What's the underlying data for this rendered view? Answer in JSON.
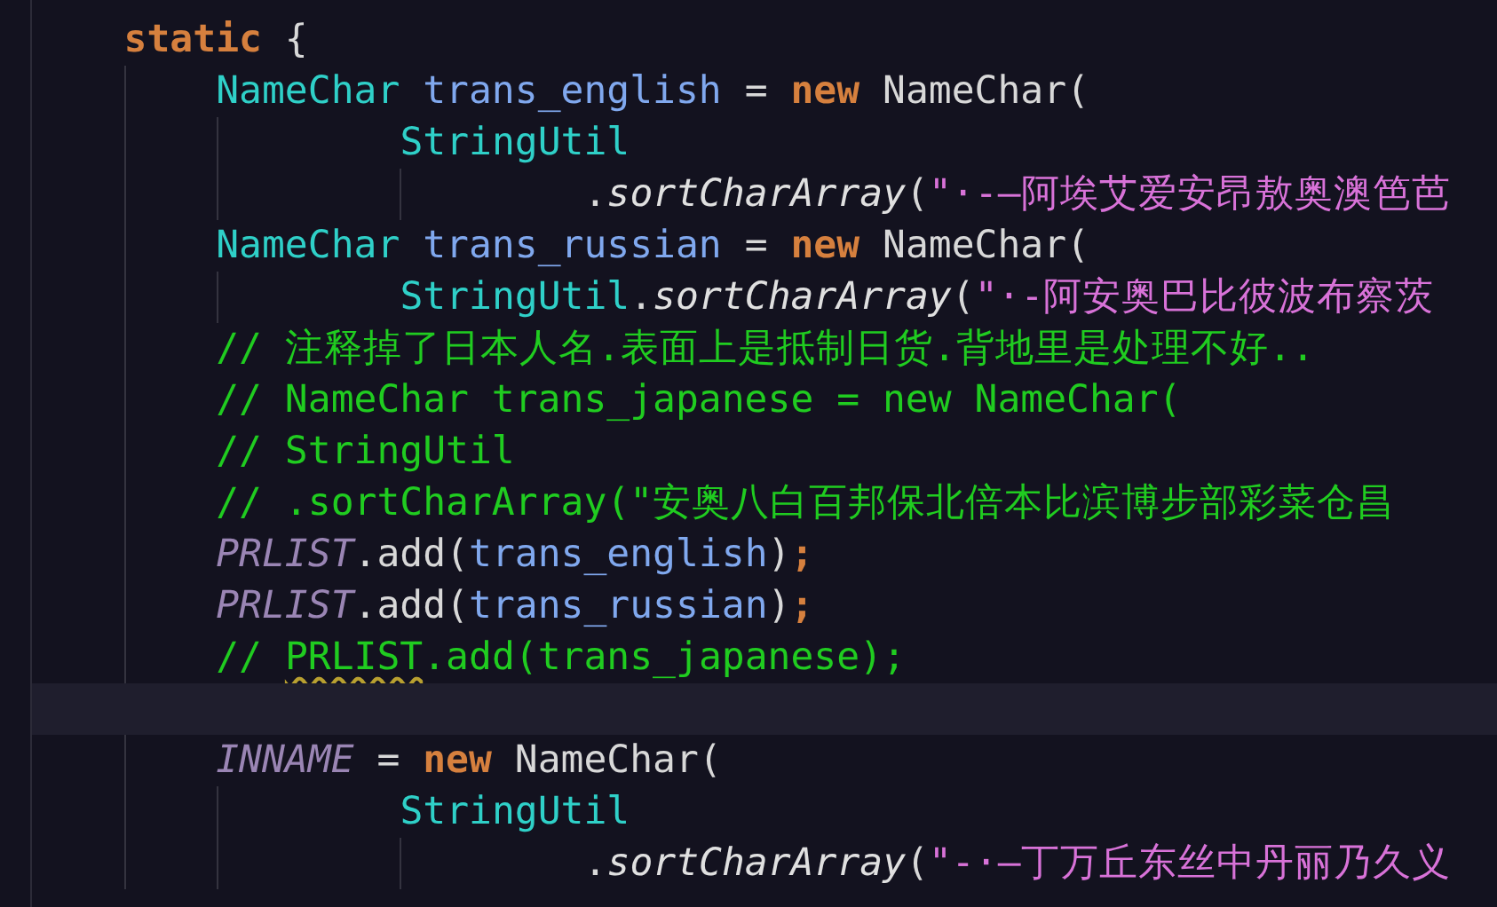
{
  "editor": {
    "lines": [
      {
        "kind": "block",
        "current": false,
        "tokens": [
          {
            "kind": "keyword",
            "text": "static"
          },
          {
            "kind": "plain",
            "text": " {"
          }
        ]
      },
      {
        "kind": "statement",
        "current": false,
        "tokens": [
          {
            "kind": "type",
            "text": "NameChar "
          },
          {
            "kind": "variable",
            "text": "trans_english"
          },
          {
            "kind": "plain",
            "text": " = "
          },
          {
            "kind": "keyword",
            "text": "new"
          },
          {
            "kind": "plain",
            "text": " NameChar("
          }
        ]
      },
      {
        "kind": "continuation",
        "current": false,
        "tokens": [
          {
            "kind": "type",
            "text": "StringUtil"
          }
        ]
      },
      {
        "kind": "argument",
        "current": false,
        "tokens": [
          {
            "kind": "plain",
            "text": "."
          },
          {
            "kind": "method",
            "text": "sortCharArray"
          },
          {
            "kind": "plain",
            "text": "("
          },
          {
            "kind": "string",
            "text": "\"·-—阿埃艾爱安昂敖奥澳笆芭"
          }
        ]
      },
      {
        "kind": "statement",
        "current": false,
        "tokens": [
          {
            "kind": "type",
            "text": "NameChar "
          },
          {
            "kind": "variable",
            "text": "trans_russian"
          },
          {
            "kind": "plain",
            "text": " = "
          },
          {
            "kind": "keyword",
            "text": "new"
          },
          {
            "kind": "plain",
            "text": " NameChar("
          }
        ]
      },
      {
        "kind": "continuation",
        "current": false,
        "tokens": [
          {
            "kind": "type",
            "text": "StringUtil"
          },
          {
            "kind": "plain",
            "text": "."
          },
          {
            "kind": "method",
            "text": "sortCharArray"
          },
          {
            "kind": "plain",
            "text": "("
          },
          {
            "kind": "string",
            "text": "\"·-阿安奥巴比彼波布察茨"
          }
        ]
      },
      {
        "kind": "statement",
        "current": false,
        "tokens": [
          {
            "kind": "comment",
            "text": "// 注释掉了日本人名.表面上是抵制日货.背地里是处理不好.."
          }
        ]
      },
      {
        "kind": "statement",
        "current": false,
        "tokens": [
          {
            "kind": "comment",
            "text": "// NameChar trans_japanese = new NameChar("
          }
        ]
      },
      {
        "kind": "statement",
        "current": false,
        "tokens": [
          {
            "kind": "comment",
            "text": "// StringUtil"
          }
        ]
      },
      {
        "kind": "statement",
        "current": false,
        "tokens": [
          {
            "kind": "comment",
            "text": "// .sortCharArray(\"安奥八白百邦保北倍本比滨博步部彩菜仓昌"
          }
        ]
      },
      {
        "kind": "statement",
        "current": false,
        "tokens": [
          {
            "kind": "field",
            "text": "PRLIST"
          },
          {
            "kind": "plain",
            "text": ".add("
          },
          {
            "kind": "variable",
            "text": "trans_english"
          },
          {
            "kind": "plain",
            "text": ")"
          },
          {
            "kind": "keyword",
            "text": ";"
          }
        ]
      },
      {
        "kind": "statement",
        "current": false,
        "tokens": [
          {
            "kind": "field",
            "text": "PRLIST"
          },
          {
            "kind": "plain",
            "text": ".add("
          },
          {
            "kind": "variable",
            "text": "trans_russian"
          },
          {
            "kind": "plain",
            "text": ")"
          },
          {
            "kind": "keyword",
            "text": ";"
          }
        ]
      },
      {
        "kind": "statement",
        "current": false,
        "tokens": [
          {
            "kind": "comment",
            "text": "// "
          },
          {
            "kind": "comment",
            "text": "PRLIST",
            "warning": true
          },
          {
            "kind": "comment",
            "text": ".add(trans_japanese);"
          }
        ]
      },
      {
        "kind": "blank",
        "current": true
      },
      {
        "kind": "statement",
        "current": false,
        "tokens": [
          {
            "kind": "field",
            "text": "INNAME"
          },
          {
            "kind": "plain",
            "text": " = "
          },
          {
            "kind": "keyword",
            "text": "new"
          },
          {
            "kind": "plain",
            "text": " NameChar("
          }
        ]
      },
      {
        "kind": "continuation",
        "current": false,
        "tokens": [
          {
            "kind": "type",
            "text": "StringUtil"
          }
        ]
      },
      {
        "kind": "argument",
        "current": false,
        "tokens": [
          {
            "kind": "plain",
            "text": "."
          },
          {
            "kind": "method",
            "text": "sortCharArray"
          },
          {
            "kind": "plain",
            "text": "("
          },
          {
            "kind": "string",
            "text": "\"-·—丁万丘东丝中丹丽乃久义"
          }
        ]
      }
    ]
  }
}
